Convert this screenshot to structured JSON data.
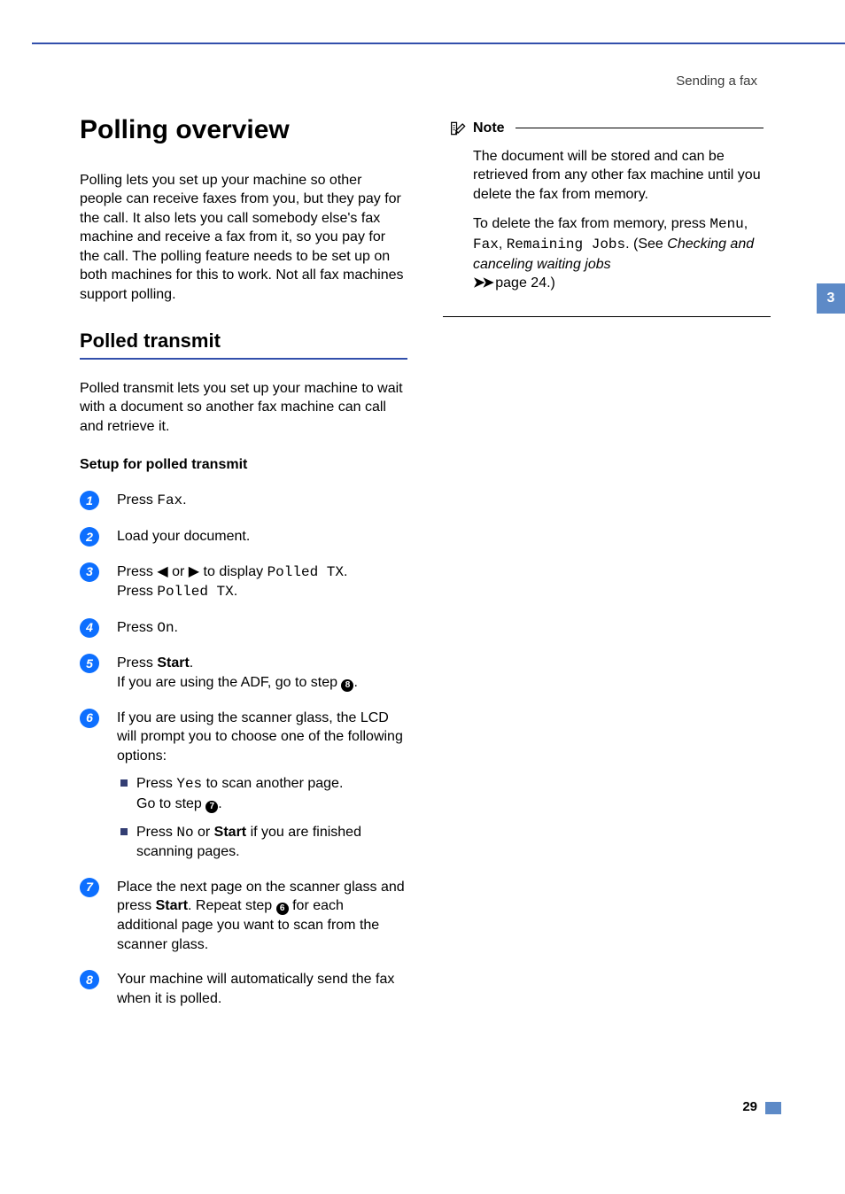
{
  "header": {
    "section": "Sending a fax"
  },
  "chapter_tab": "3",
  "page_number": "29",
  "title": "Polling overview",
  "intro": "Polling lets you set up your machine so other people can receive faxes from you, but they pay for the call. It also lets you call somebody else's fax machine and receive a fax from it, so you pay for the call. The polling feature needs to be set up on both machines for this to work. Not all fax machines support polling.",
  "section": {
    "heading": "Polled transmit",
    "lead": "Polled transmit lets you set up your machine to wait with a document so another fax machine can call and retrieve it.",
    "subheading": "Setup for polled transmit"
  },
  "steps": {
    "s1": {
      "n": "1",
      "pre": "Press ",
      "code": "Fax",
      "post": "."
    },
    "s2": {
      "n": "2",
      "text": "Load your document."
    },
    "s3": {
      "n": "3",
      "line1_pre": "Press ",
      "line1_mid": " or ",
      "line1_post": " to display ",
      "code1": "Polled TX",
      "end1": ".",
      "line2_pre": "Press ",
      "code2": "Polled TX",
      "end2": "."
    },
    "s4": {
      "n": "4",
      "pre": "Press ",
      "code": "On",
      "post": "."
    },
    "s5": {
      "n": "5",
      "line1_pre": "Press ",
      "bold": "Start",
      "line1_post": ".",
      "line2_pre": "If you are using the ADF, go to step ",
      "ref": "8",
      "line2_post": "."
    },
    "s6": {
      "n": "6",
      "intro": "If you are using the scanner glass, the LCD will prompt you to choose one of the following options:",
      "b1_pre": "Press ",
      "b1_code": "Yes",
      "b1_post": " to scan another page.",
      "b1_l2_pre": "Go to step ",
      "b1_ref": "7",
      "b1_l2_post": ".",
      "b2_pre": "Press ",
      "b2_code": "No",
      "b2_mid": " or ",
      "b2_bold": "Start",
      "b2_post": " if you are finished scanning pages."
    },
    "s7": {
      "n": "7",
      "pre": "Place the next page on the scanner glass and press ",
      "bold": "Start",
      "mid": ". Repeat step ",
      "ref": "6",
      "post": " for each additional page you want to scan from the scanner glass."
    },
    "s8": {
      "n": "8",
      "text": "Your machine will automatically send the fax when it is polled."
    }
  },
  "note": {
    "label": "Note",
    "p1": "The document will be stored and can be retrieved from any other fax machine until you delete the fax from memory.",
    "p2_pre": "To delete the fax from memory, press ",
    "p2_code1": "Menu",
    "p2_c1": ", ",
    "p2_code2": "Fax",
    "p2_c2": ", ",
    "p2_code3": "Remaining Jobs",
    "p2_post": ". (See ",
    "p2_italic": "Checking and canceling waiting jobs",
    "p2_tail_pre": " page ",
    "p2_page": "24",
    "p2_tail_post": ".)"
  }
}
